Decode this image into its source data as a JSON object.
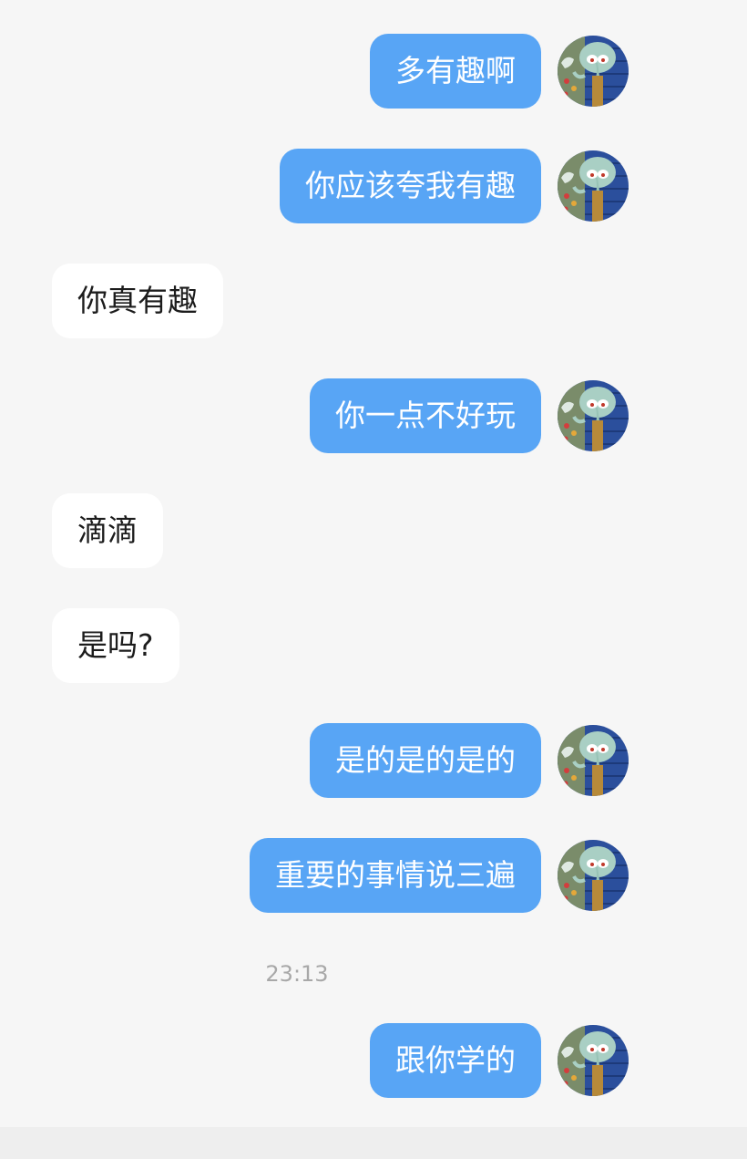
{
  "messages": [
    {
      "side": "out",
      "text": "多有趣啊"
    },
    {
      "side": "out",
      "text": "你应该夸我有趣"
    },
    {
      "side": "in",
      "text": "你真有趣"
    },
    {
      "side": "out",
      "text": "你一点不好玩"
    },
    {
      "side": "in",
      "text": "滴滴"
    },
    {
      "side": "in",
      "text": "是吗?"
    },
    {
      "side": "out",
      "text": "是的是的是的"
    },
    {
      "side": "out",
      "text": "重要的事情说三遍"
    },
    {
      "side": "out",
      "text": "跟你学的"
    }
  ],
  "timestamp": "23:13",
  "avatar": {
    "icon": "squidward-avatar-icon"
  },
  "colors": {
    "outgoing_bubble": "#58a5f5",
    "incoming_bubble": "#ffffff",
    "background": "#f6f6f6",
    "timestamp": "#a8a8a8"
  }
}
